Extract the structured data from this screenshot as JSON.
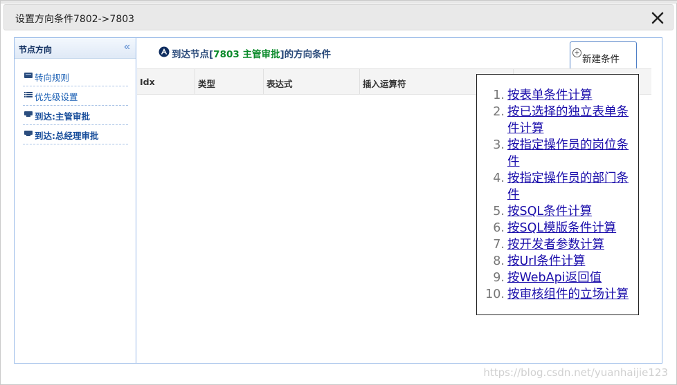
{
  "dialog": {
    "title": "设置方向条件7802->7803"
  },
  "left_panel": {
    "header": "节点方向",
    "collapse_glyph": "«",
    "items": [
      {
        "label": "转向规则",
        "bold": false
      },
      {
        "label": "优先级设置",
        "bold": false
      },
      {
        "label": "到达:主管审批",
        "bold": true
      },
      {
        "label": "到达:总经理审批",
        "bold": true
      }
    ]
  },
  "main": {
    "title_prefix": "到达节点[",
    "title_node": "7803 主管审批",
    "title_suffix": "]的方向条件",
    "new_button_label": "新建条件",
    "columns": [
      "Idx",
      "类型",
      "表达式",
      "插入运算符"
    ]
  },
  "dropdown": {
    "items": [
      {
        "num": "1.",
        "label": "按表单条件计算"
      },
      {
        "num": "2.",
        "label": "按已选择的独立表单条件计算"
      },
      {
        "num": "3.",
        "label": "按指定操作员的岗位条件"
      },
      {
        "num": "4.",
        "label": "按指定操作员的部门条件"
      },
      {
        "num": "5.",
        "label": "按SQL条件计算"
      },
      {
        "num": "6.",
        "label": "按SQL模版条件计算"
      },
      {
        "num": "7.",
        "label": "按开发者参数计算"
      },
      {
        "num": "8.",
        "label": "按Url条件计算"
      },
      {
        "num": "9.",
        "label": "按WebApi返回值"
      },
      {
        "num": "10.",
        "label": "按审核组件的立场计算"
      }
    ]
  },
  "watermark": "https://blog.csdn.net/yuanhaijie123"
}
